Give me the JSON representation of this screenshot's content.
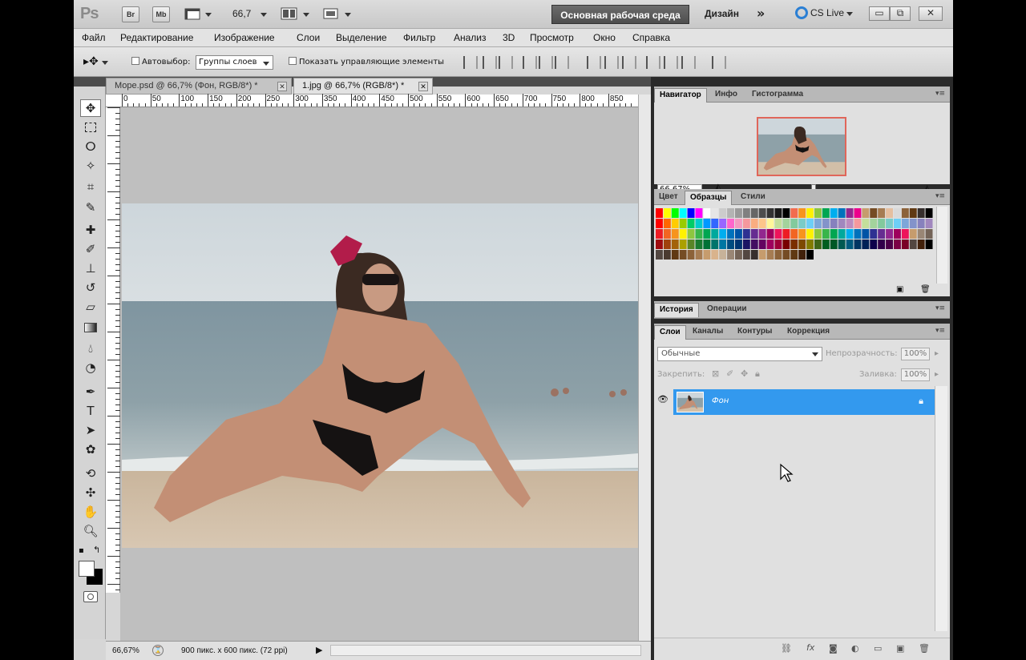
{
  "appbar": {
    "logo": "Ps",
    "bridge": "Br",
    "minibridge": "Mb",
    "zoom": "66,7",
    "workspace_active": "Основная рабочая среда",
    "workspace_design": "Дизайн",
    "more": "»",
    "cslive": "CS Live",
    "minimize": "▭",
    "restore": "⧉",
    "close": "✕"
  },
  "menu": [
    "Файл",
    "Редактирование",
    "Изображение",
    "Слои",
    "Выделение",
    "Фильтр",
    "Анализ",
    "3D",
    "Просмотр",
    "Окно",
    "Справка"
  ],
  "options": {
    "autoselect_label": "Автовыбор:",
    "autoselect_value": "Группы слоев",
    "show_controls_label": "Показать управляющие элементы"
  },
  "tabs": [
    {
      "label": "Море.psd @ 66,7% (Фон, RGB/8*) *",
      "active": false
    },
    {
      "label": "1.jpg @ 66,7% (RGB/8*) *",
      "active": true
    }
  ],
  "ruler_top": [
    "0",
    "50",
    "100",
    "150",
    "200",
    "250",
    "300",
    "350",
    "400",
    "450",
    "500",
    "550",
    "600",
    "650",
    "700",
    "750",
    "800",
    "850"
  ],
  "status": {
    "zoom": "66,67%",
    "info": "900 пикс. x 600 пикс. (72 ppi)"
  },
  "navigator": {
    "tabs": [
      "Навигатор",
      "Инфо",
      "Гистограмма"
    ],
    "zoom": "66.67%"
  },
  "swatches_panel": {
    "tabs": [
      "Цвет",
      "Образцы",
      "Стили"
    ],
    "rows": [
      [
        "#ff0000",
        "#ffff00",
        "#00ff00",
        "#00ffff",
        "#0000ff",
        "#ff00ff",
        "#ffffff",
        "#e6e6e6",
        "#cccccc",
        "#b3b3b3",
        "#999999",
        "#808080",
        "#666666",
        "#4d4d4d",
        "#333333",
        "#1a1a1a",
        "#000000",
        "#f26c4f",
        "#f7941d",
        "#fff200",
        "#8dc63f",
        "#00a651",
        "#00aeef",
        "#0072bc",
        "#92278f",
        "#ec008c",
        "#c69c6d",
        "#754c24",
        "#a67c52",
        "#e5bfa0",
        "#d9d9d9",
        "#8c6239",
        "#603913",
        "#362f2d",
        "#000000"
      ],
      [
        "#ff0000",
        "#ff6600",
        "#ffcc00",
        "#99cc00",
        "#00cc66",
        "#00cccc",
        "#0099ff",
        "#3366ff",
        "#9966ff",
        "#ff66cc",
        "#f49ac1",
        "#f5989d",
        "#f9ad81",
        "#fdc68a",
        "#fff79a",
        "#c4df9b",
        "#a3d39c",
        "#82ca9d",
        "#7accc8",
        "#6dcff6",
        "#7da7d9",
        "#8393ca",
        "#8781bd",
        "#a187be",
        "#bd8cbf",
        "#f6989d",
        "#c4df9b",
        "#a3d39c",
        "#82ca9d",
        "#7accc8",
        "#6dcff6",
        "#7da7d9",
        "#8393ca",
        "#8781bd",
        "#a187be"
      ],
      [
        "#ed1c24",
        "#f26522",
        "#f7941d",
        "#fff200",
        "#8dc63f",
        "#39b54a",
        "#00a651",
        "#00a99d",
        "#00aeef",
        "#0072bc",
        "#0054a6",
        "#2e3192",
        "#662d91",
        "#92278f",
        "#9e005d",
        "#ed145b",
        "#ed1c24",
        "#f26522",
        "#f7941d",
        "#fff200",
        "#8dc63f",
        "#39b54a",
        "#00a651",
        "#00a99d",
        "#00aeef",
        "#0072bc",
        "#0054a6",
        "#2e3192",
        "#662d91",
        "#92278f",
        "#9e005d",
        "#ed145b",
        "#c69c6d",
        "#998675",
        "#736357"
      ],
      [
        "#9e0b0f",
        "#a0410d",
        "#a36209",
        "#aba000",
        "#598527",
        "#1a7b30",
        "#007236",
        "#00746b",
        "#0076a3",
        "#004b80",
        "#003471",
        "#1b1464",
        "#440e62",
        "#630460",
        "#9e005d",
        "#9e0039",
        "#790000",
        "#7b2e00",
        "#7d4900",
        "#827b00",
        "#406618",
        "#005e20",
        "#005826",
        "#005952",
        "#005b7f",
        "#003663",
        "#002157",
        "#0d004c",
        "#32004b",
        "#4b0049",
        "#7b0046",
        "#7a0026",
        "#534741",
        "#42210b",
        "#000000"
      ],
      [
        "#534741",
        "#4a3a30",
        "#603913",
        "#754c24",
        "#8c6239",
        "#a67c52",
        "#c69c6d",
        "#d9b38c",
        "#c7b299",
        "#998675",
        "#736357",
        "#534741",
        "#362f2d",
        "#c69c6d",
        "#a67c52",
        "#8c6239",
        "#754c24",
        "#603913",
        "#42210b",
        "#000000"
      ]
    ]
  },
  "history_panel": {
    "tabs": [
      "История",
      "Операции"
    ]
  },
  "layers_panel": {
    "tabs": [
      "Слои",
      "Каналы",
      "Контуры",
      "Коррекция"
    ],
    "blend": "Обычные",
    "opacity_label": "Непрозрачность:",
    "opacity": "100%",
    "lock_label": "Закрепить:",
    "fill_label": "Заливка:",
    "fill": "100%",
    "layer_name": "Фон"
  }
}
